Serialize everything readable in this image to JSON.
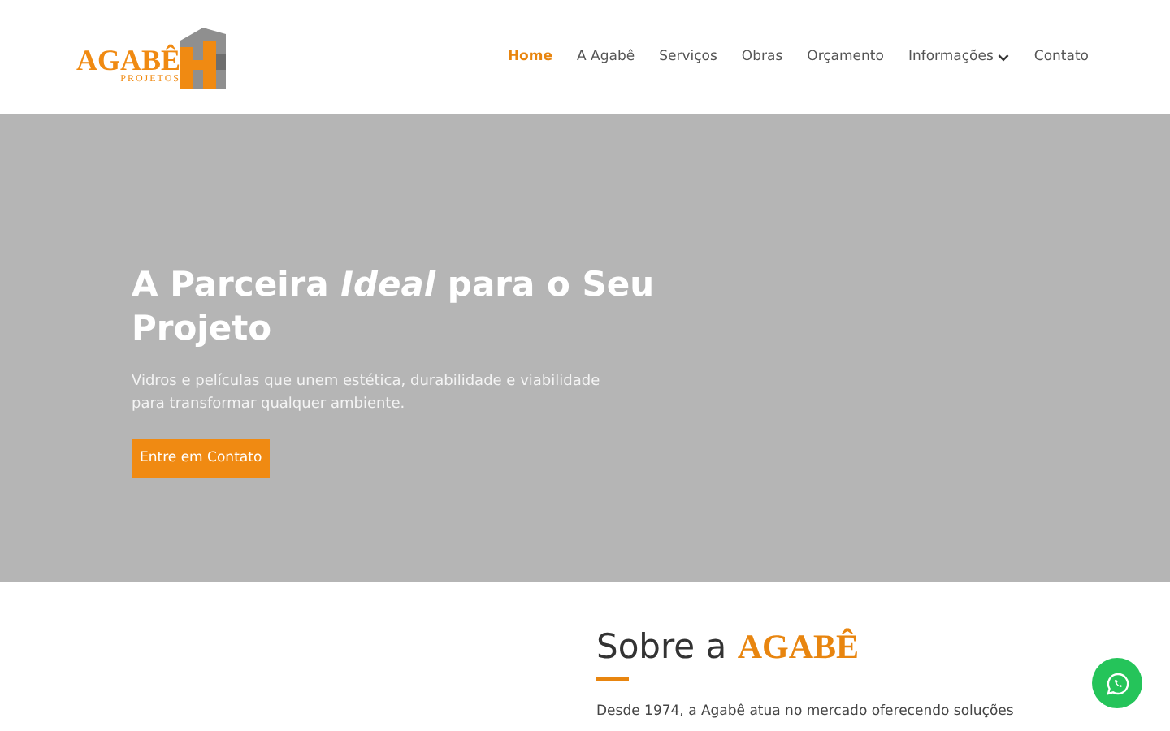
{
  "logo": {
    "name": "AGABÊ",
    "tagline": "PROJETOS"
  },
  "nav": [
    {
      "label": "Home",
      "selected": true,
      "dropdown": false
    },
    {
      "label": "A Agabê",
      "selected": false,
      "dropdown": false
    },
    {
      "label": "Serviços",
      "selected": false,
      "dropdown": false
    },
    {
      "label": "Obras",
      "selected": false,
      "dropdown": false
    },
    {
      "label": "Orçamento",
      "selected": false,
      "dropdown": false
    },
    {
      "label": "Informações",
      "selected": false,
      "dropdown": true
    },
    {
      "label": "Contato",
      "selected": false,
      "dropdown": false
    }
  ],
  "hero": {
    "title": "A Parceira *Ideal* para o Seu Projeto",
    "subtitle": "Vidros e películas que unem estética, durabilidade e viabilidade para transformar qualquer ambiente.",
    "button": "Entre em Contato"
  },
  "about": {
    "title": "Sobre a",
    "brand": "AGABÊ",
    "text": "Desde 1974, a Agabê atua no mercado oferecendo soluções"
  }
}
